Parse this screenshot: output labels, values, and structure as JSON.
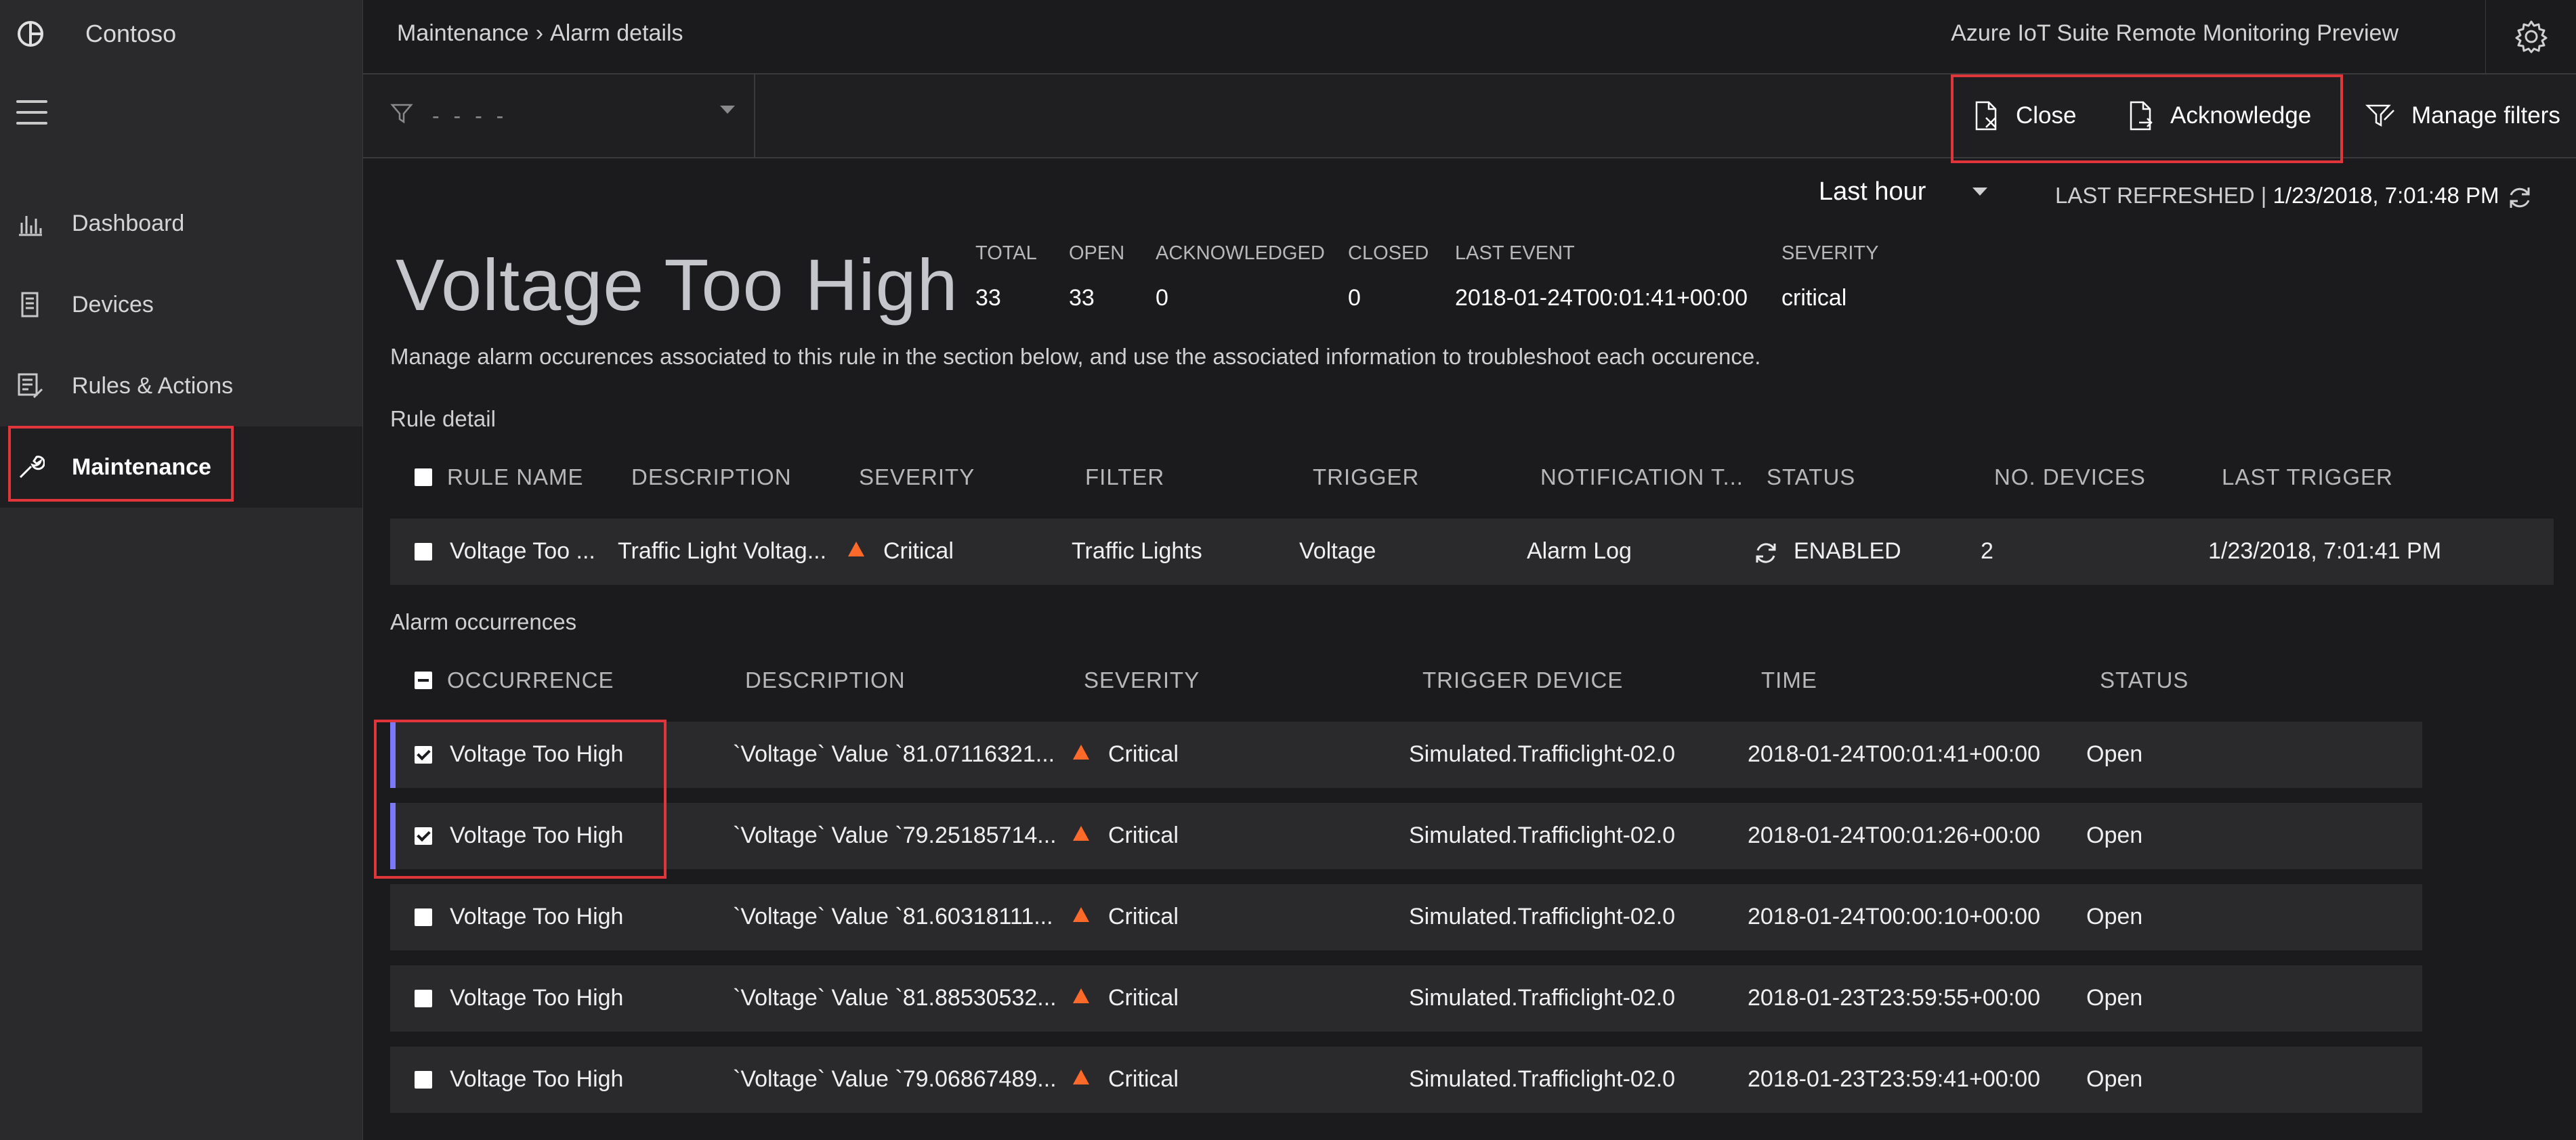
{
  "sidebar": {
    "brand": "Contoso",
    "items": [
      {
        "label": "Dashboard",
        "icon": "dashboard-icon"
      },
      {
        "label": "Devices",
        "icon": "devices-icon"
      },
      {
        "label": "Rules & Actions",
        "icon": "rules-icon"
      },
      {
        "label": "Maintenance",
        "icon": "maintenance-icon",
        "active": true
      }
    ]
  },
  "header": {
    "breadcrumb_root": "Maintenance",
    "breadcrumb_sep": "›",
    "breadcrumb_current": "Alarm details",
    "app_title": "Azure IoT Suite Remote Monitoring Preview"
  },
  "toolbar": {
    "filter_placeholder": "- - - -",
    "close_label": "Close",
    "acknowledge_label": "Acknowledge",
    "manage_filters_label": "Manage filters"
  },
  "timeframe": {
    "selected": "Last hour",
    "last_refreshed_label": "LAST REFRESHED |",
    "last_refreshed_value": "1/23/2018, 7:01:48 PM"
  },
  "summary": {
    "title": "Voltage Too High",
    "stats": [
      {
        "key": "TOTAL",
        "value": "33"
      },
      {
        "key": "OPEN",
        "value": "33"
      },
      {
        "key": "ACKNOWLEDGED",
        "value": "0"
      },
      {
        "key": "CLOSED",
        "value": "0"
      },
      {
        "key": "LAST EVENT",
        "value": "2018-01-24T00:01:41+00:00"
      },
      {
        "key": "SEVERITY",
        "value": "critical"
      }
    ],
    "description": "Manage alarm occurences associated to this rule in the section below, and use the associated information to troubleshoot each occurence."
  },
  "rule_detail": {
    "section_label": "Rule detail",
    "headers": [
      "RULE NAME",
      "DESCRIPTION",
      "SEVERITY",
      "FILTER",
      "TRIGGER",
      "NOTIFICATION T...",
      "STATUS",
      "NO. DEVICES",
      "LAST TRIGGER"
    ],
    "row": {
      "rule_name": "Voltage Too ...",
      "description": "Traffic Light Voltag...",
      "severity": "Critical",
      "filter": "Traffic Lights",
      "trigger": "Voltage",
      "notification": "Alarm Log",
      "status": "ENABLED",
      "devices": "2",
      "last_trigger": "1/23/2018, 7:01:41 PM"
    }
  },
  "occurrences": {
    "section_label": "Alarm occurrences",
    "headers": [
      "OCCURRENCE",
      "DESCRIPTION",
      "SEVERITY",
      "TRIGGER DEVICE",
      "TIME",
      "STATUS"
    ],
    "rows": [
      {
        "name": "Voltage Too High",
        "description": "`Voltage` Value `81.07116321...",
        "severity": "Critical",
        "device": "Simulated.Trafficlight-02.0",
        "time": "2018-01-24T00:01:41+00:00",
        "status": "Open",
        "checked": true
      },
      {
        "name": "Voltage Too High",
        "description": "`Voltage` Value `79.25185714...",
        "severity": "Critical",
        "device": "Simulated.Trafficlight-02.0",
        "time": "2018-01-24T00:01:26+00:00",
        "status": "Open",
        "checked": true
      },
      {
        "name": "Voltage Too High",
        "description": "`Voltage` Value `81.60318111...",
        "severity": "Critical",
        "device": "Simulated.Trafficlight-02.0",
        "time": "2018-01-24T00:00:10+00:00",
        "status": "Open",
        "checked": false
      },
      {
        "name": "Voltage Too High",
        "description": "`Voltage` Value `81.88530532...",
        "severity": "Critical",
        "device": "Simulated.Trafficlight-02.0",
        "time": "2018-01-23T23:59:55+00:00",
        "status": "Open",
        "checked": false
      },
      {
        "name": "Voltage Too High",
        "description": "`Voltage` Value `79.06867489...",
        "severity": "Critical",
        "device": "Simulated.Trafficlight-02.0",
        "time": "2018-01-23T23:59:41+00:00",
        "status": "Open",
        "checked": false
      }
    ]
  },
  "colors": {
    "accent": "#7b79f7",
    "highlight": "#e0353a",
    "severity_critical": "#ff6a2a"
  }
}
